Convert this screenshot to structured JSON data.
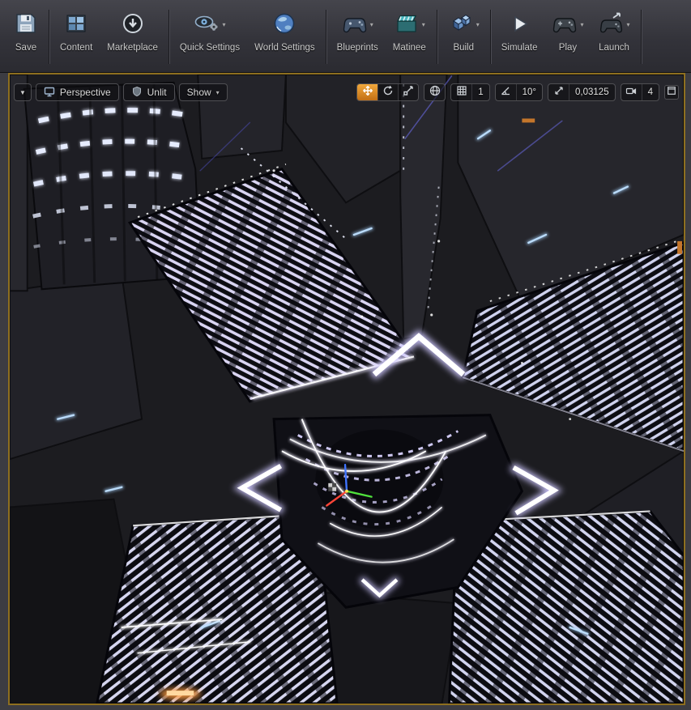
{
  "toolbar": {
    "dropdown_caret": "▾",
    "buttons": [
      {
        "id": "save",
        "label": "Save",
        "dropdown": false
      },
      {
        "id": "content",
        "label": "Content",
        "dropdown": false
      },
      {
        "id": "marketplace",
        "label": "Marketplace",
        "dropdown": false
      },
      {
        "id": "quick-settings",
        "label": "Quick Settings",
        "dropdown": true
      },
      {
        "id": "world-settings",
        "label": "World Settings",
        "dropdown": false
      },
      {
        "id": "blueprints",
        "label": "Blueprints",
        "dropdown": true
      },
      {
        "id": "matinee",
        "label": "Matinee",
        "dropdown": true
      },
      {
        "id": "build",
        "label": "Build",
        "dropdown": true
      },
      {
        "id": "simulate",
        "label": "Simulate",
        "dropdown": false
      },
      {
        "id": "play",
        "label": "Play",
        "dropdown": true
      },
      {
        "id": "launch",
        "label": "Launch",
        "dropdown": true
      }
    ]
  },
  "viewport": {
    "options_caret": "▼",
    "toolbar_left": {
      "perspective_label": "Perspective",
      "view_mode_label": "Unlit",
      "show_label": "Show"
    },
    "toolbar_right": {
      "active_tool": "move",
      "grid_snap_value": "1",
      "rotation_snap_value": "10°",
      "scale_snap_value": "0,03125",
      "camera_speed_value": "4"
    },
    "border_color": "#8e6f1f"
  },
  "colors": {
    "active_tool_orange": "#d08326",
    "glow_light": "#e6e2fa",
    "toolbar_bg": "#33333a"
  }
}
